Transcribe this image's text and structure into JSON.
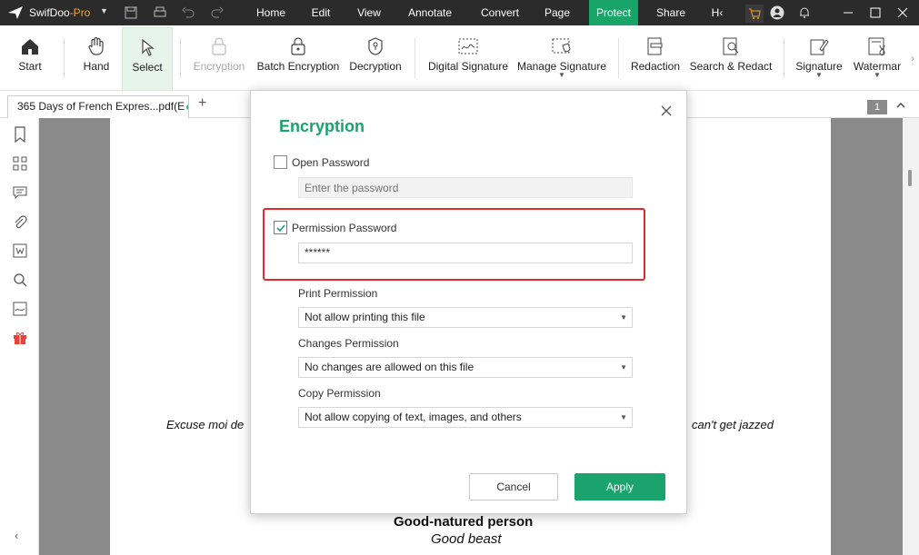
{
  "app": {
    "name": "SwifDoo",
    "edition": "-Pro"
  },
  "menu": [
    "Home",
    "Edit",
    "View",
    "Annotate",
    "Convert",
    "Page",
    "Protect",
    "Share",
    "H‹"
  ],
  "ribbon": {
    "start": "Start",
    "hand": "Hand",
    "select": "Select",
    "encryption": "Encryption",
    "batch_encryption": "Batch Encryption",
    "decryption": "Decryption",
    "digital_signature": "Digital Signature",
    "manage_signature": "Manage Signature",
    "redaction": "Redaction",
    "search_redact": "Search & Redact",
    "signature": "Signature",
    "watermark": "Watermar"
  },
  "tab": {
    "title": "365 Days of French Expres...pdf(E"
  },
  "page_badge": "1",
  "document": {
    "line_left": "Excuse moi de",
    "line_right": "can't get jazzed",
    "heading": "Good-natured person",
    "subheading": "Good beast"
  },
  "dialog": {
    "title": "Encryption",
    "open_password": {
      "label": "Open Password",
      "checked": false,
      "placeholder": "Enter the password"
    },
    "permission_password": {
      "label": "Permission Password",
      "checked": true,
      "value": "******"
    },
    "print_permission": {
      "label": "Print Permission",
      "selected": "Not allow printing this file"
    },
    "changes_permission": {
      "label": "Changes Permission",
      "selected": "No changes are allowed on this file"
    },
    "copy_permission": {
      "label": "Copy Permission",
      "selected": "Not allow copying of text, images, and others"
    },
    "cancel": "Cancel",
    "apply": "Apply"
  },
  "colors": {
    "accent": "#1aa36d",
    "titlebar": "#2b2b2b",
    "highlight": "#e02b2b",
    "protect_tab": "#19a56a"
  }
}
